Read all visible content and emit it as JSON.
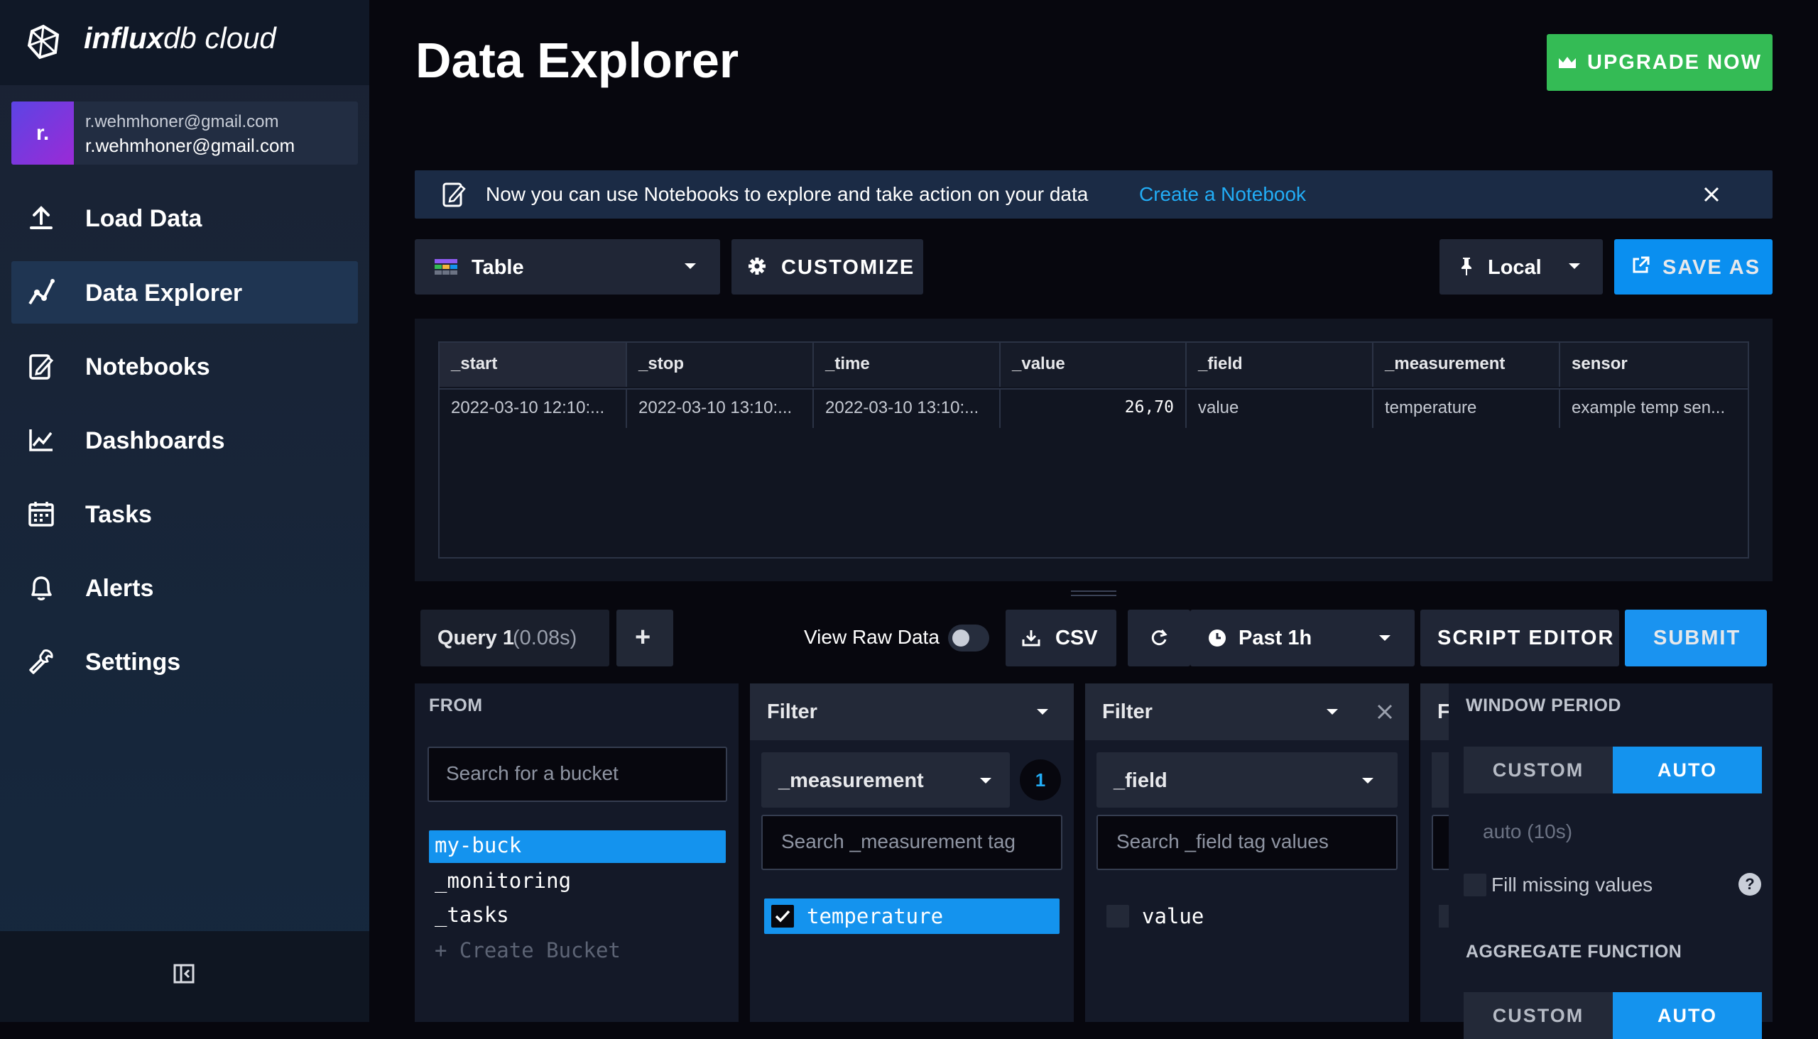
{
  "app": {
    "logo_bold": "influx",
    "logo_light": "db cloud"
  },
  "user": {
    "avatar_initial": "r.",
    "org": "r.wehmhoner@gmail.com",
    "email": "r.wehmhoner@gmail.com"
  },
  "sidebar": {
    "items": [
      {
        "label": "Load Data",
        "icon": "upload-icon"
      },
      {
        "label": "Data Explorer",
        "icon": "graph-line-icon",
        "active": true
      },
      {
        "label": "Notebooks",
        "icon": "notebook-icon"
      },
      {
        "label": "Dashboards",
        "icon": "chart-icon"
      },
      {
        "label": "Tasks",
        "icon": "calendar-icon"
      },
      {
        "label": "Alerts",
        "icon": "bell-icon"
      },
      {
        "label": "Settings",
        "icon": "wrench-icon"
      }
    ],
    "collapse_icon": "collapse-sidebar-icon"
  },
  "header": {
    "title": "Data Explorer",
    "upgrade_label": "UPGRADE NOW"
  },
  "banner": {
    "text": "Now you can use Notebooks to explore and take action on your data",
    "link": "Create a Notebook"
  },
  "toolbar": {
    "vis_type": "Table",
    "customize": "CUSTOMIZE",
    "timezone": "Local",
    "save_as": "SAVE AS"
  },
  "table": {
    "columns": [
      "_start",
      "_stop",
      "_time",
      "_value",
      "_field",
      "_measurement",
      "sensor"
    ],
    "rows": [
      [
        "2022-03-10 12:10:...",
        "2022-03-10 13:10:...",
        "2022-03-10 13:10:...",
        "26,70",
        "value",
        "temperature",
        "example temp sen..."
      ]
    ]
  },
  "query": {
    "tab_name": "Query 1",
    "tab_time": "(0.08s)",
    "add": "+",
    "raw_label": "View Raw Data",
    "csv": "CSV",
    "time_range": "Past 1h",
    "script_editor": "SCRIPT EDITOR",
    "submit": "SUBMIT"
  },
  "builder": {
    "from": {
      "title": "FROM",
      "search_placeholder": "Search for a bucket",
      "buckets": [
        "my-buck",
        "_monitoring",
        "_tasks"
      ],
      "selected_bucket": "my-buck",
      "create": "+ Create Bucket"
    },
    "filter1": {
      "title": "Filter",
      "key": "_measurement",
      "count": "1",
      "search_placeholder": "Search _measurement tag",
      "values": [
        {
          "label": "temperature",
          "checked": true
        }
      ]
    },
    "filter2": {
      "title": "Filter",
      "key": "_field",
      "search_placeholder": "Search _field tag values",
      "values": [
        {
          "label": "value",
          "checked": false
        }
      ]
    },
    "filter3": {
      "title": "F"
    },
    "window": {
      "title": "WINDOW PERIOD",
      "custom": "CUSTOM",
      "auto": "AUTO",
      "auto_value": "auto (10s)",
      "fill_label": "Fill missing values",
      "help": "?",
      "agg_title": "AGGREGATE FUNCTION",
      "agg_custom": "CUSTOM",
      "agg_auto": "AUTO"
    }
  },
  "colors": {
    "accent": "#1493ee",
    "upgrade": "#34bb55",
    "link": "#22adf6"
  }
}
